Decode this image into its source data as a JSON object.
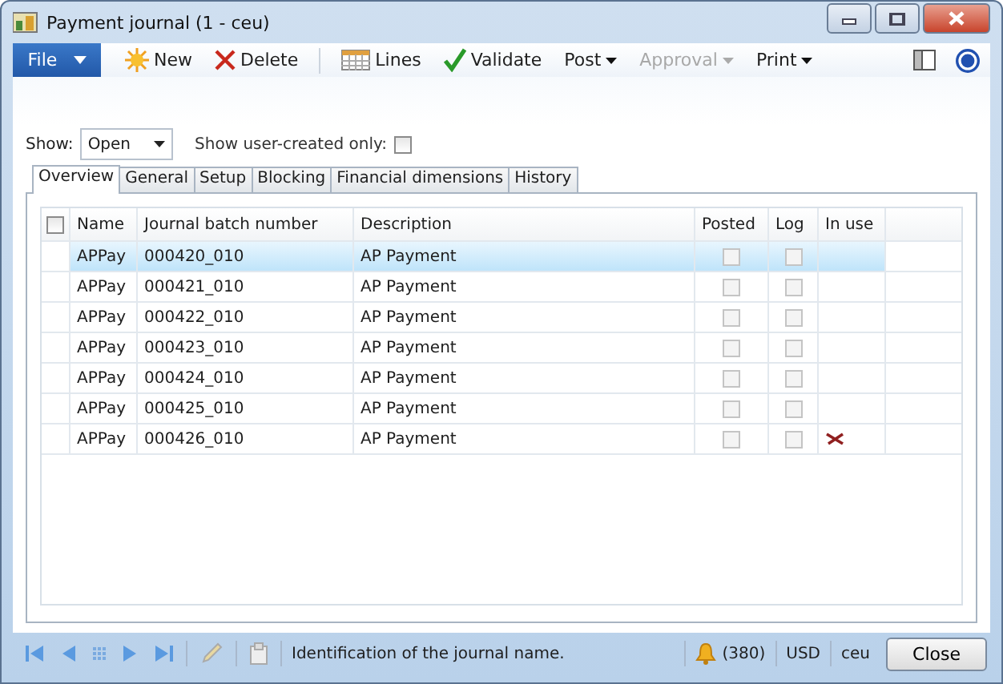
{
  "window": {
    "title": "Payment journal (1 - ceu)"
  },
  "toolbar": [
    {
      "label": "File",
      "kind": "file",
      "disabled": false
    },
    {
      "label": "New",
      "kind": "new",
      "disabled": false
    },
    {
      "label": "Delete",
      "kind": "delete",
      "disabled": false
    },
    {
      "label": "Lines",
      "kind": "lines",
      "disabled": false
    },
    {
      "label": "Validate",
      "kind": "validate",
      "disabled": false
    },
    {
      "label": "Post",
      "kind": "menu",
      "disabled": false
    },
    {
      "label": "Approval",
      "kind": "menu",
      "disabled": true
    },
    {
      "label": "Print",
      "kind": "menu",
      "disabled": false
    }
  ],
  "filter": {
    "show_label": "Show:",
    "show_value": "Open",
    "user_created_label": "Show user-created only:",
    "user_created_checked": false
  },
  "tabs": [
    {
      "label": "Overview",
      "selected": true
    },
    {
      "label": "General",
      "selected": false
    },
    {
      "label": "Setup",
      "selected": false
    },
    {
      "label": "Blocking",
      "selected": false
    },
    {
      "label": "Financial dimensions",
      "selected": false
    },
    {
      "label": "History",
      "selected": false
    }
  ],
  "table": {
    "select_all_checked": false,
    "columns": [
      "Name",
      "Journal batch number",
      "Description",
      "Posted",
      "Log",
      "In use"
    ],
    "rows": [
      {
        "name": "APPay",
        "batch": "000420_010",
        "description": "AP Payment",
        "posted": false,
        "log": false,
        "in_use": false,
        "selected": true
      },
      {
        "name": "APPay",
        "batch": "000421_010",
        "description": "AP Payment",
        "posted": false,
        "log": false,
        "in_use": false,
        "selected": false
      },
      {
        "name": "APPay",
        "batch": "000422_010",
        "description": "AP Payment",
        "posted": false,
        "log": false,
        "in_use": false,
        "selected": false
      },
      {
        "name": "APPay",
        "batch": "000423_010",
        "description": "AP Payment",
        "posted": false,
        "log": false,
        "in_use": false,
        "selected": false
      },
      {
        "name": "APPay",
        "batch": "000424_010",
        "description": "AP Payment",
        "posted": false,
        "log": false,
        "in_use": false,
        "selected": false
      },
      {
        "name": "APPay",
        "batch": "000425_010",
        "description": "AP Payment",
        "posted": false,
        "log": false,
        "in_use": false,
        "selected": false
      },
      {
        "name": "APPay",
        "batch": "000426_010",
        "description": "AP Payment",
        "posted": false,
        "log": false,
        "in_use": true,
        "selected": false
      }
    ]
  },
  "status_bar": {
    "help_text": "Identification of the journal name.",
    "notifications": "(380)",
    "currency": "USD",
    "company": "ceu",
    "close_button": "Close"
  }
}
